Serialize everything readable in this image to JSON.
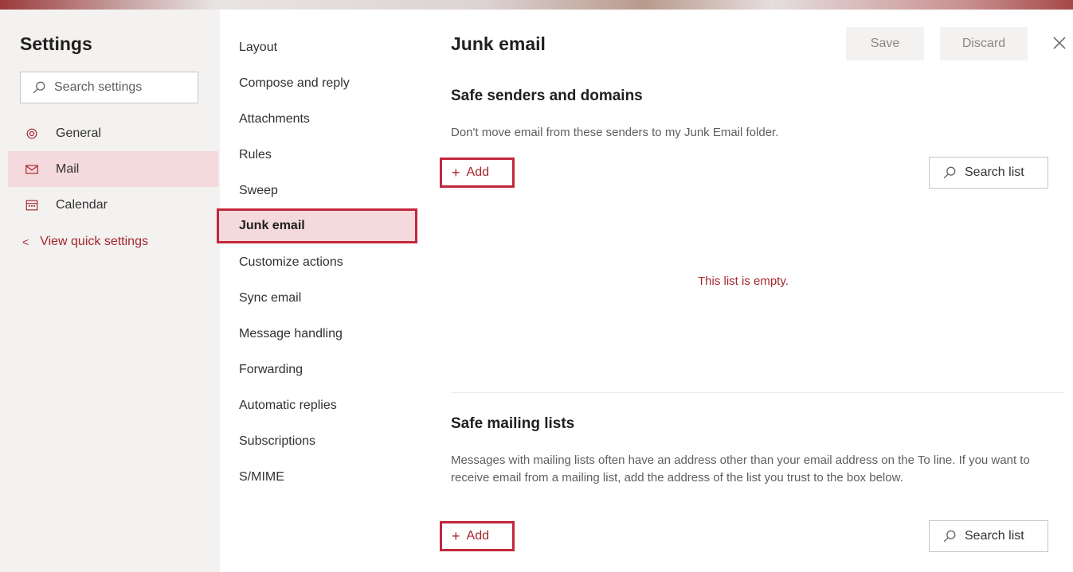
{
  "settings_panel": {
    "title": "Settings",
    "search_placeholder": "Search settings",
    "nav": [
      {
        "label": "General",
        "icon": "gear-icon"
      },
      {
        "label": "Mail",
        "icon": "mail-icon",
        "selected": true
      },
      {
        "label": "Calendar",
        "icon": "calendar-icon"
      }
    ],
    "quick_settings_link": "View quick settings"
  },
  "mail_menu": {
    "items": [
      "Layout",
      "Compose and reply",
      "Attachments",
      "Rules",
      "Sweep",
      "Junk email",
      "Customize actions",
      "Sync email",
      "Message handling",
      "Forwarding",
      "Automatic replies",
      "Subscriptions",
      "S/MIME"
    ],
    "selected": "Junk email"
  },
  "junk_email": {
    "title": "Junk email",
    "save_label": "Save",
    "discard_label": "Discard",
    "safe_senders": {
      "title": "Safe senders and domains",
      "description": "Don't move email from these senders to my Junk Email folder.",
      "add_label": "Add",
      "search_label": "Search list",
      "empty_message": "This list is empty."
    },
    "safe_mailing_lists": {
      "title": "Safe mailing lists",
      "description": "Messages with mailing lists often have an address other than your email address on the To line. If you want to receive email from a mailing list, add the address of the list you trust to the box below.",
      "add_label": "Add",
      "search_label": "Search list"
    }
  },
  "colors": {
    "accent": "#a4262c",
    "highlight_border": "#c3273b",
    "selected_bg": "#f4d9dd",
    "left_panel_bg": "#f3f2f1"
  }
}
